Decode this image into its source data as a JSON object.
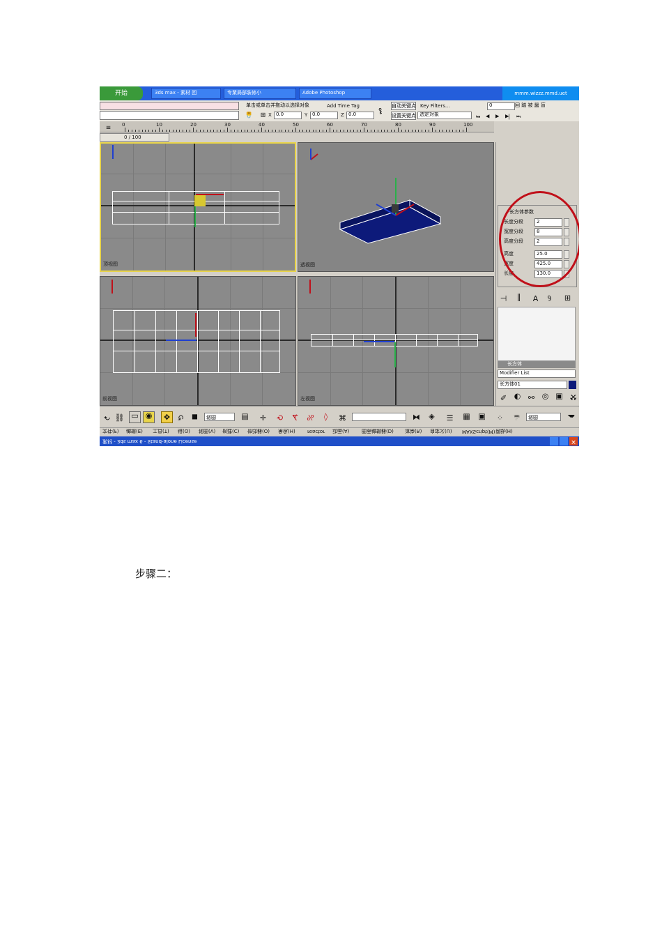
{
  "taskbar": {
    "start": "开始",
    "buttons": [
      "3ds max - 素材 回",
      "专業局部装修小",
      "Adobe Photoshop"
    ],
    "clock": "mmm.wizzz.mmd.uet"
  },
  "toolbar_top": {
    "status_field": "",
    "help_text": "单击或单击并拖动以选择对象",
    "add_time_tag": "Add Time Tag",
    "x_label": "X",
    "x_value": "0.0",
    "y_label": "Y",
    "y_value": "0.0",
    "z_label": "Z",
    "z_value": "0.0",
    "auto_key": "自动关键点",
    "set_key": "设置关键点",
    "key_filters": "Key Filters...",
    "selected": "选定对象",
    "frame": "0",
    "right_tag": "回 踏 被 醤 盲"
  },
  "timeline": {
    "range": "0 / 100",
    "ticks": [
      "0",
      "10",
      "20",
      "30",
      "40",
      "50",
      "60",
      "70",
      "80",
      "90",
      "100"
    ]
  },
  "viewports": {
    "top": "顶视图",
    "perspective": "透视图",
    "front": "前视图",
    "left": "左视图"
  },
  "command_panel": {
    "rollup_title": "长方体参数",
    "length_segs_label": "长度分段",
    "length_segs": "2",
    "width_segs_label": "宽度分段",
    "width_segs": "8",
    "height_segs_label": "高度分段",
    "height_segs": "2",
    "height_label": "高度",
    "height": "25.0",
    "width_label": "宽度",
    "width": "425.0",
    "length_label": "长度",
    "length": "130.0",
    "object_name": "长方体01",
    "modifier_list": "Modifier List",
    "stack_item": "长方体"
  },
  "main_toolbar": {
    "view_dropdown": "视图",
    "selection_set": "",
    "right_dropdown": "视图"
  },
  "menus": [
    "文件(F)",
    "编辑(E)",
    "工具(T)",
    "组(G)",
    "视图(V)",
    "创建(C)",
    "修改器(O)",
    "角色(H)",
    "reactor",
    "动画(A)",
    "图表编辑器(D)",
    "渲染(R)",
    "自定义(U)",
    "MAXScript(M)",
    "帮助(H)"
  ],
  "window_title": "素材 - 3ds max 6 - Stand-alone License",
  "colors": {
    "box_fill": "#0d1a7a",
    "circle": "#c0101a",
    "active_border": "#e8d44a",
    "taskbar": "#245edb"
  },
  "caption": "步骤二："
}
